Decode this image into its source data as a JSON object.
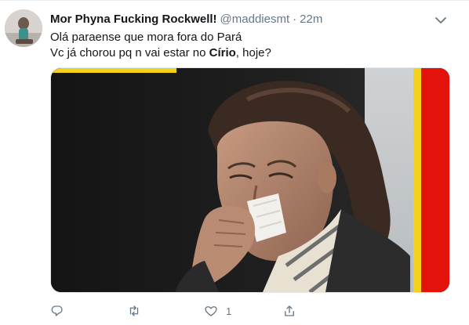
{
  "tweet": {
    "display_name": "Mor Phyna Fucking Rockwell!",
    "handle": "@maddiesmt",
    "separator": "·",
    "time": "22m",
    "line1": "Olá paraense que mora fora do Pará",
    "line2_before": "Vc já chorou pq n vai estar no ",
    "line2_bold": "Círio",
    "line2_after": ", hoje?"
  },
  "actions": {
    "reply": {
      "icon": "reply-icon",
      "count": ""
    },
    "retweet": {
      "icon": "retweet-icon",
      "count": ""
    },
    "like": {
      "icon": "heart-icon",
      "count": "1"
    },
    "share": {
      "icon": "share-icon",
      "count": ""
    }
  },
  "media": {
    "description_icon": "photo-woman-crying-with-tissue",
    "accent_colors": {
      "frame_red": "#e3120b",
      "frame_yellow": "#f4d21c"
    }
  },
  "colors": {
    "text": "#14171a",
    "secondary": "#657786",
    "divider": "#e6ecf0"
  }
}
